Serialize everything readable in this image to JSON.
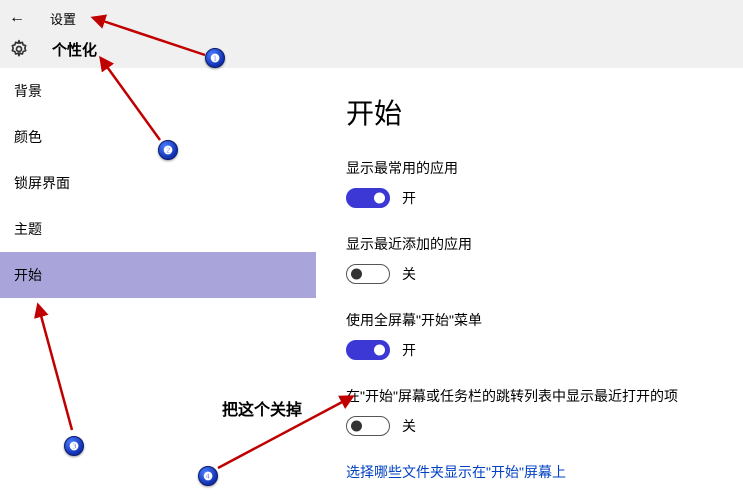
{
  "header": {
    "back_glyph": "←",
    "title": "设置",
    "category": "个性化"
  },
  "sidebar": {
    "items": [
      {
        "label": "背景",
        "selected": false
      },
      {
        "label": "颜色",
        "selected": false
      },
      {
        "label": "锁屏界面",
        "selected": false
      },
      {
        "label": "主题",
        "selected": false
      },
      {
        "label": "开始",
        "selected": true
      }
    ]
  },
  "main": {
    "title": "开始",
    "settings": [
      {
        "label": "显示最常用的应用",
        "on": true,
        "state_on": "开",
        "state_off": "关"
      },
      {
        "label": "显示最近添加的应用",
        "on": false,
        "state_on": "开",
        "state_off": "关"
      },
      {
        "label": "使用全屏幕\"开始\"菜单",
        "on": true,
        "state_on": "开",
        "state_off": "关"
      },
      {
        "label": "在\"开始\"屏幕或任务栏的跳转列表中显示最近打开的项",
        "on": false,
        "state_on": "开",
        "state_off": "关"
      }
    ],
    "link": "选择哪些文件夹显示在\"开始\"屏幕上"
  },
  "annotations": {
    "badges": [
      "❶",
      "❷",
      "❸",
      "❹"
    ],
    "hint": "把这个关掉"
  }
}
